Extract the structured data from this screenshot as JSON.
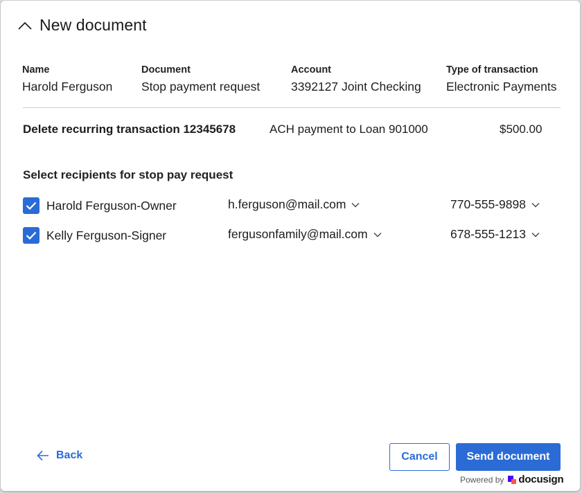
{
  "header": {
    "title": "New document",
    "collapse_icon": "chevron-up-icon"
  },
  "details": {
    "name": {
      "label": "Name",
      "value": "Harold Ferguson"
    },
    "document": {
      "label": "Document",
      "value": "Stop payment request"
    },
    "account": {
      "label": "Account",
      "value": "3392127 Joint Checking"
    },
    "transaction_type": {
      "label": "Type of transaction",
      "value": "Electronic Payments"
    }
  },
  "transaction": {
    "title": "Delete recurring transaction 12345678",
    "description": "ACH payment to Loan 901000",
    "amount": "$500.00"
  },
  "recipients_section": {
    "title": "Select recipients for stop pay request",
    "recipients": [
      {
        "name": "Harold Ferguson-Owner",
        "email": "h.ferguson@mail.com",
        "phone": "770-555-9898",
        "checked": true
      },
      {
        "name": "Kelly Ferguson-Signer",
        "email": "fergusonfamily@mail.com",
        "phone": "678-555-1213",
        "checked": true
      }
    ]
  },
  "footer": {
    "back_label": "Back",
    "cancel_label": "Cancel",
    "send_label": "Send document",
    "powered_by": "Powered by",
    "brand": "docusign"
  },
  "colors": {
    "accent": "#2a6bd6",
    "brand_purple": "#4c00ff",
    "brand_red": "#ff5252"
  }
}
